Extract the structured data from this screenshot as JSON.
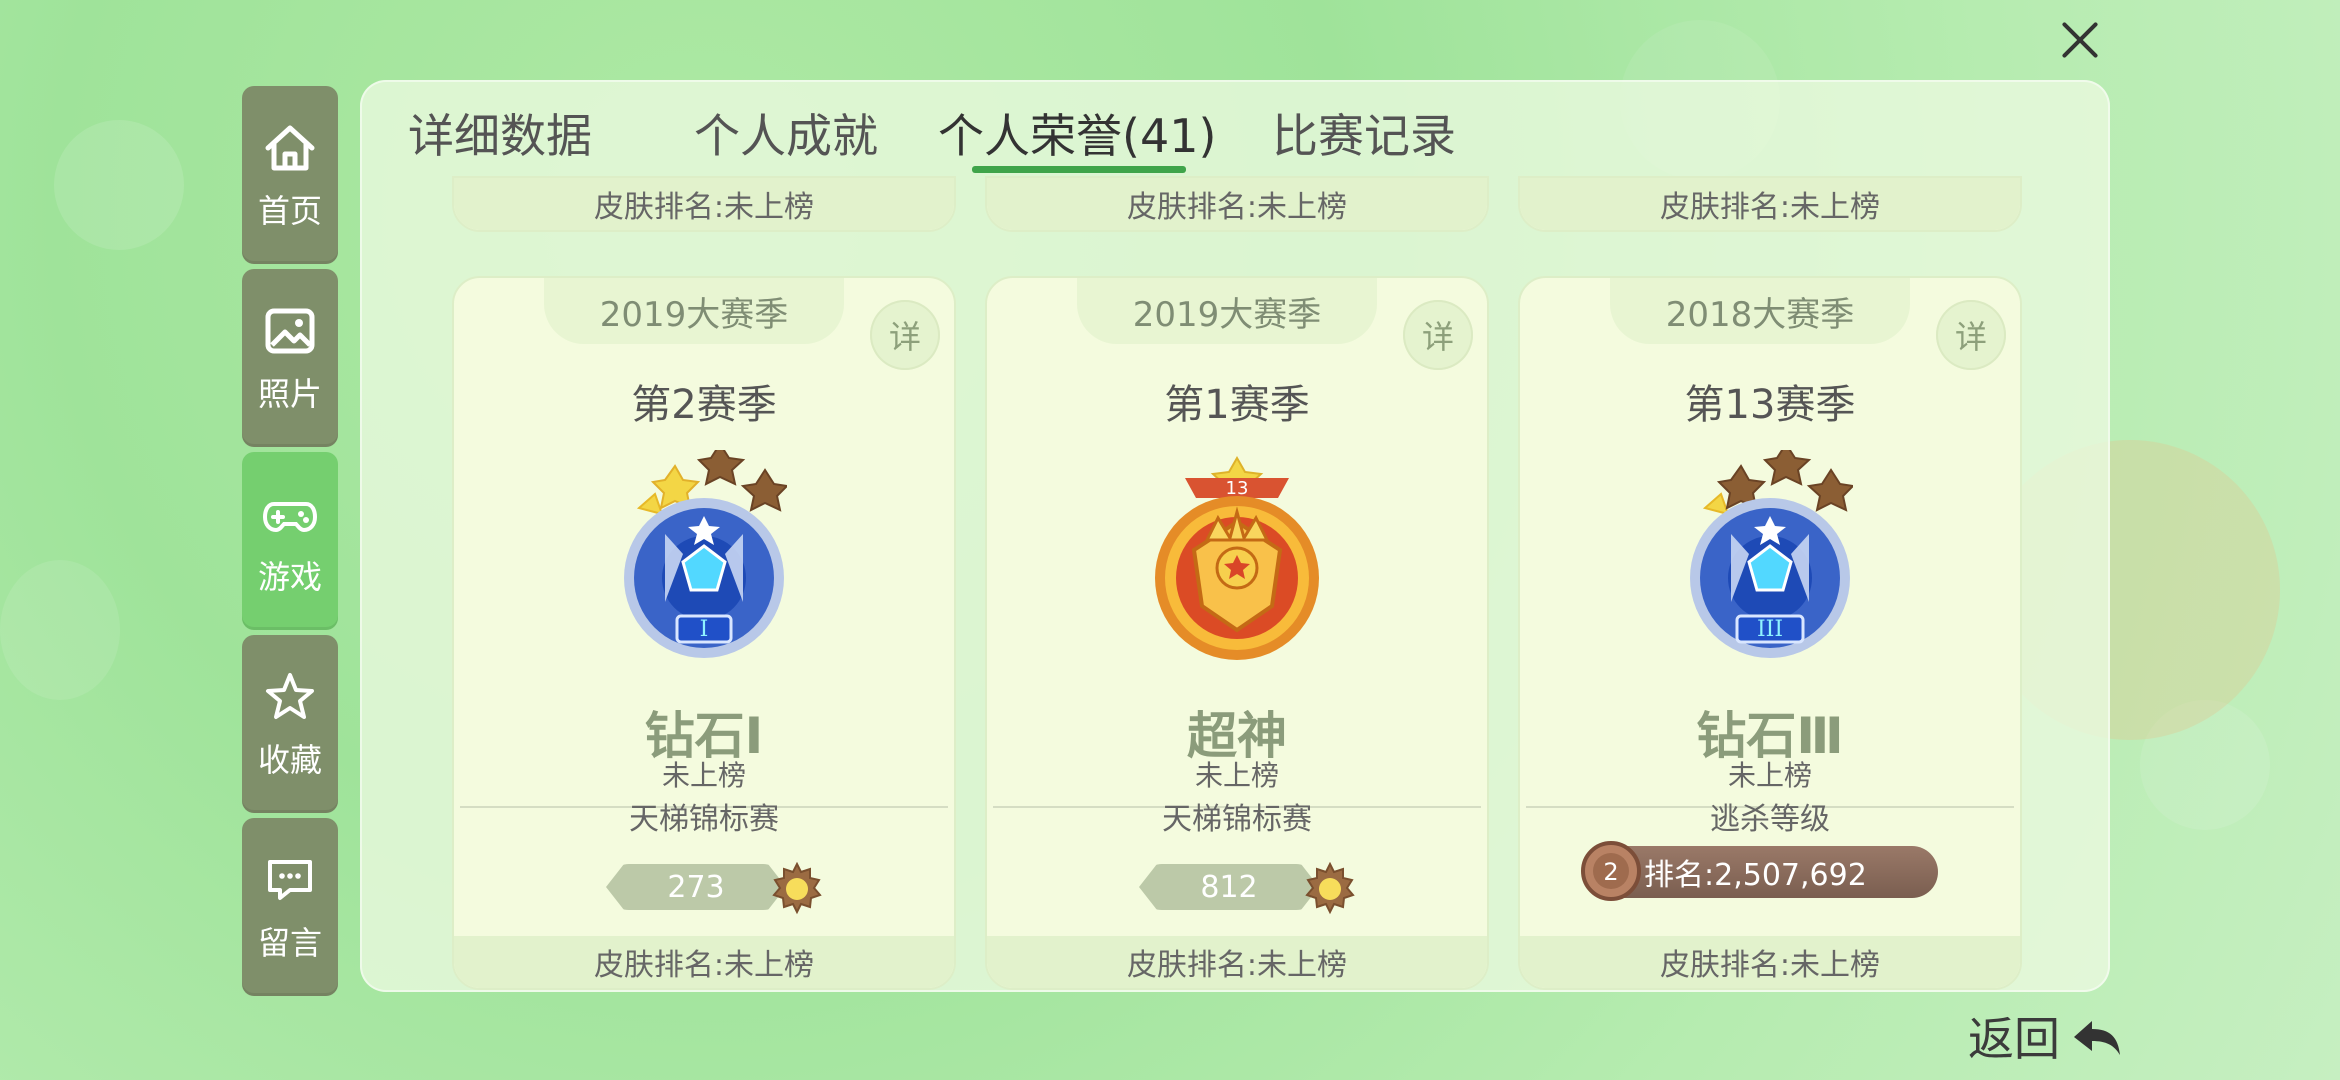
{
  "sidebar": {
    "items": [
      {
        "label": "首页",
        "icon": "home-icon"
      },
      {
        "label": "照片",
        "icon": "photo-icon"
      },
      {
        "label": "游戏",
        "icon": "gamepad-icon"
      },
      {
        "label": "收藏",
        "icon": "star-icon"
      },
      {
        "label": "留言",
        "icon": "message-icon"
      }
    ]
  },
  "tabs": [
    "详细数据",
    "个人成就",
    "个人荣誉(41)",
    "比赛记录"
  ],
  "top_cards": [
    "皮肤排名:未上榜",
    "皮肤排名:未上榜",
    "皮肤排名:未上榜"
  ],
  "cards": [
    {
      "season_tab": "2019大赛季",
      "detail": "详",
      "season": "第2赛季",
      "rank_name": "钻石Ⅰ",
      "rank_status": "未上榜",
      "mode": "天梯锦标赛",
      "score": "273",
      "footer": "皮肤排名:未上榜"
    },
    {
      "season_tab": "2019大赛季",
      "detail": "详",
      "season": "第1赛季",
      "rank_name": "超神",
      "rank_status": "未上榜",
      "mode": "天梯锦标赛",
      "score": "812",
      "footer": "皮肤排名:未上榜",
      "badge_number": "13"
    },
    {
      "season_tab": "2018大赛季",
      "detail": "详",
      "season": "第13赛季",
      "rank_name": "钻石Ⅲ",
      "rank_status": "未上榜",
      "mode": "逃杀等级",
      "rank_badge_number": "2",
      "rank_text": "排名:2,507,692",
      "footer": "皮肤排名:未上榜"
    }
  ],
  "back_label": "返回",
  "colors": {
    "active_tab_underline": "#3fa44a",
    "active_sidebar": "#75cf6f",
    "sidebar": "#7f8f6a"
  }
}
